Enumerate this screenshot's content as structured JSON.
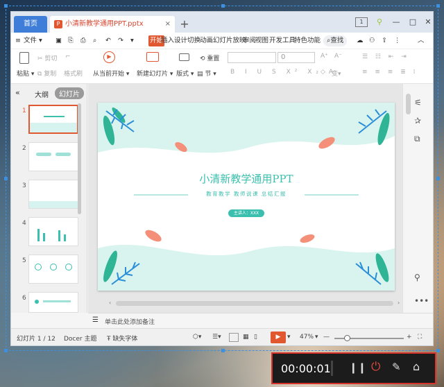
{
  "tabs": {
    "home": "首页",
    "doc": "小清新教学通用PPT.pptx",
    "add": "+"
  },
  "window_controls": {
    "badge": "1",
    "minimize": "—",
    "restore": "□",
    "close": "✕"
  },
  "menu": {
    "file": "文件",
    "items": [
      "开始",
      "插入",
      "设计",
      "切换",
      "动画",
      "幻灯片放映",
      "审阅",
      "视图",
      "开发工具",
      "特色功能"
    ],
    "search": "查找"
  },
  "ribbon": {
    "paste": "粘贴",
    "cut": "剪切",
    "copy": "复制",
    "format_painter": "格式刷",
    "play_from_current": "从当前开始",
    "new_slide": "新建幻灯片",
    "layout": "版式",
    "section": "节",
    "reset": "重置",
    "font_size": "0"
  },
  "panel": {
    "outline_tab": "大纲",
    "slides_tab": "幻灯片",
    "collapse": "«",
    "add": "+"
  },
  "thumbnails": [
    "1",
    "2",
    "3",
    "4",
    "5",
    "6"
  ],
  "slide": {
    "title": "小清新教学通用PPT",
    "subtitle": "教育教学  教师说课  总结汇报",
    "presenter": "主讲人：XXX"
  },
  "notes": {
    "placeholder": "单击此处添加备注"
  },
  "status": {
    "slide_count": "幻灯片 1 / 12",
    "theme": "Docer 主题",
    "missing_font": "缺失字体",
    "zoom": "47%"
  },
  "recorder": {
    "time": "00:00:01"
  },
  "colors": {
    "accent": "#e1572f",
    "blue": "#3e7ed8",
    "teal": "#3bbfae",
    "rec_border": "#d9342b"
  }
}
